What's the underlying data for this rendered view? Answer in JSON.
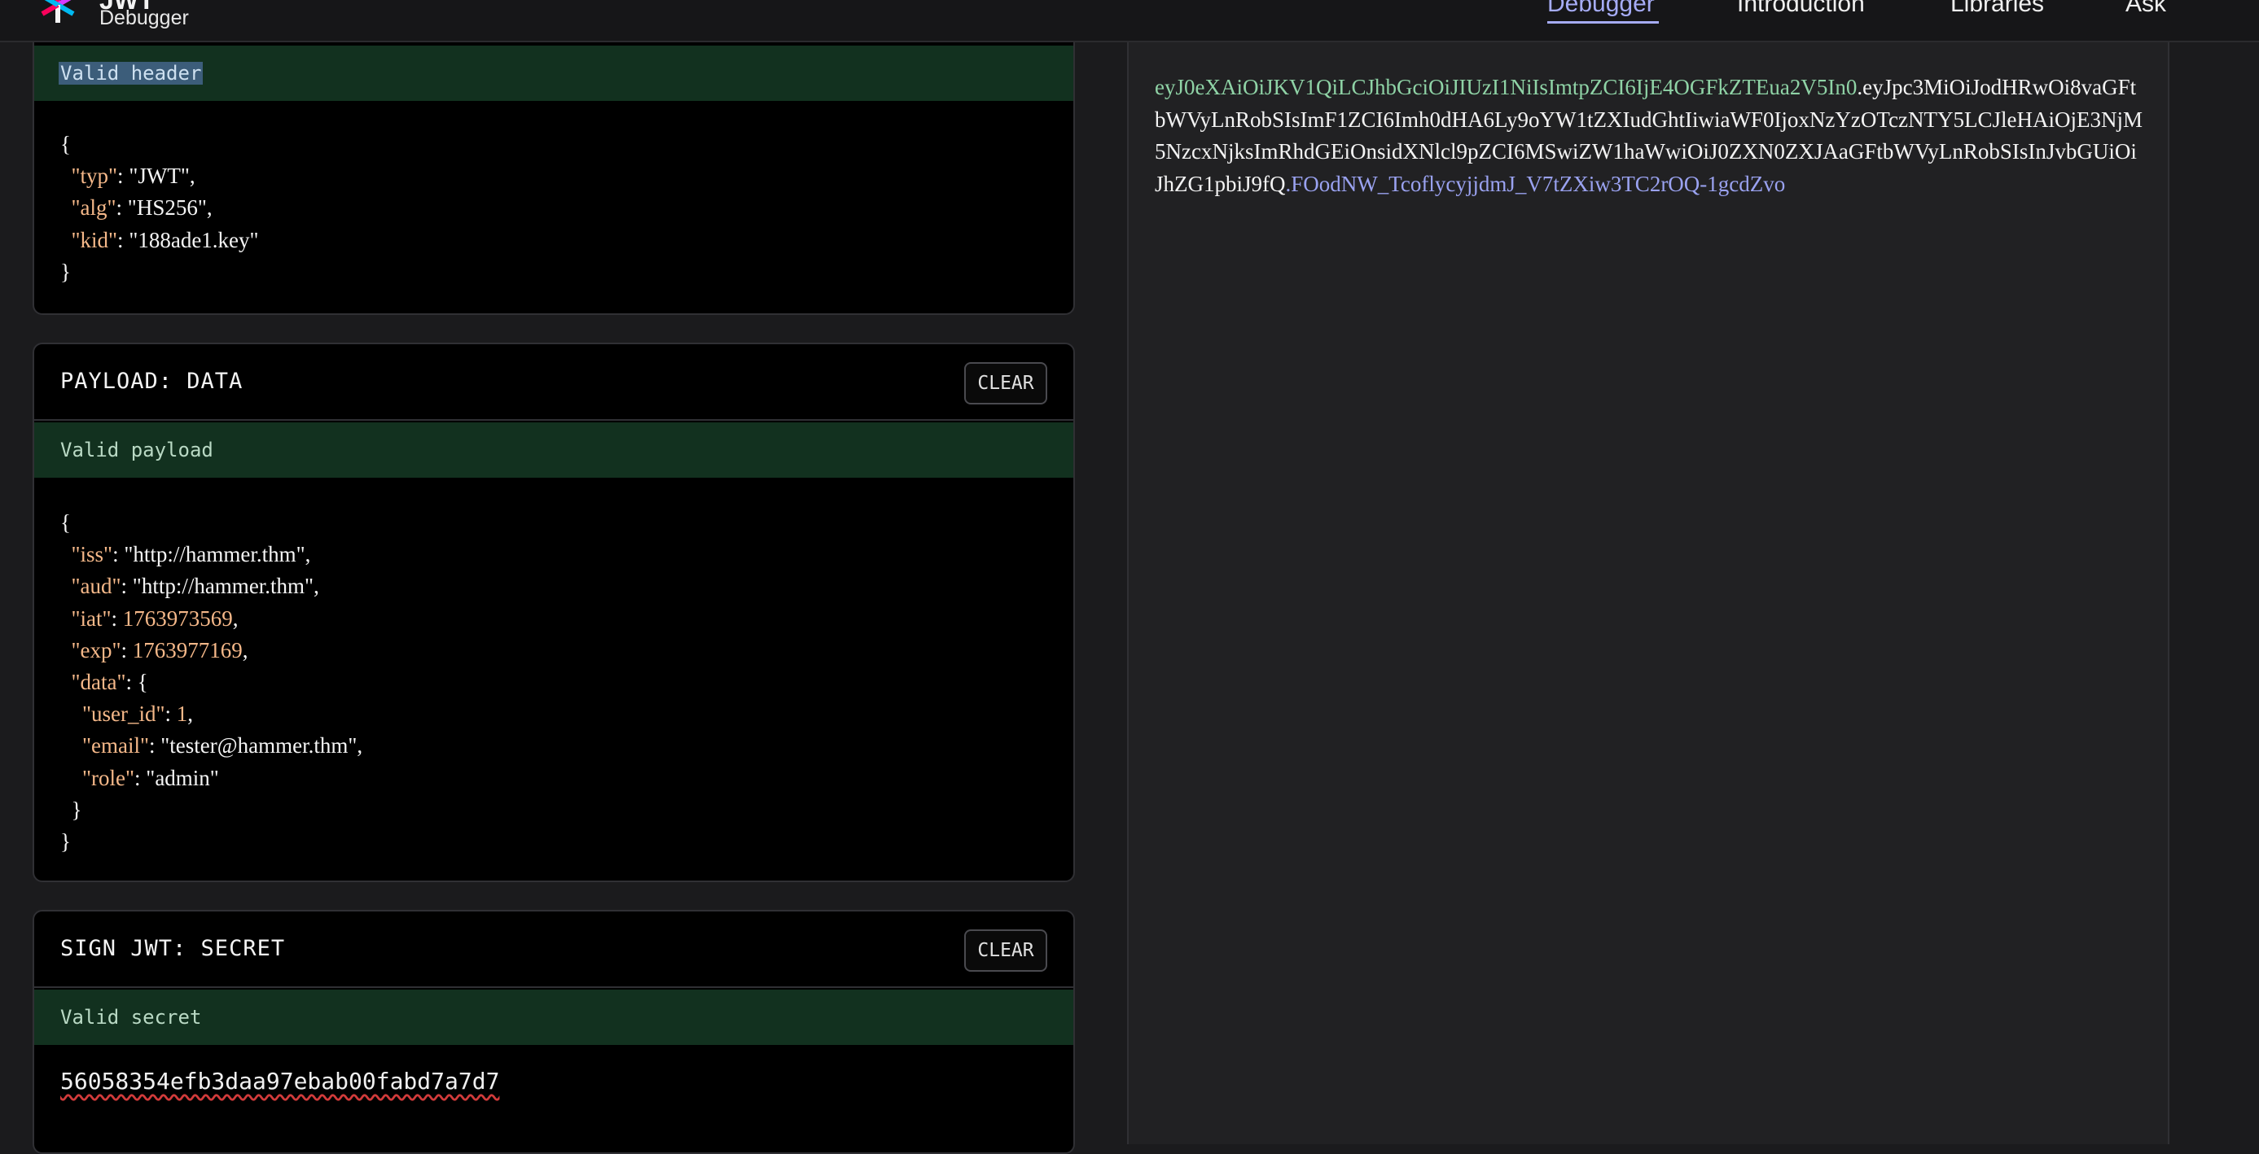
{
  "brand": {
    "title": "JWT",
    "subtitle": "Debugger"
  },
  "nav": {
    "items": [
      {
        "label": "Debugger",
        "active": true
      },
      {
        "label": "Introduction"
      },
      {
        "label": "Libraries"
      },
      {
        "label": "Ask"
      }
    ]
  },
  "header_panel": {
    "status": "Valid header",
    "lines": [
      "{",
      "  \"typ\": \"JWT\",",
      "  \"alg\": \"HS256\",",
      "  \"kid\": \"188ade1.key\"",
      "}"
    ],
    "fields": {
      "typ": "\"JWT\"",
      "alg": "\"HS256\"",
      "kid": "\"188ade1.key\""
    }
  },
  "payload_panel": {
    "title": "PAYLOAD: DATA",
    "clear_label": "CLEAR",
    "status": "Valid payload",
    "fields": {
      "iss": "\"http://hammer.thm\"",
      "aud": "\"http://hammer.thm\"",
      "iat": "1763973569",
      "exp": "1763977169",
      "user_id": "1",
      "email": "\"tester@hammer.thm\"",
      "role": "\"admin\""
    }
  },
  "secret_panel": {
    "title": "SIGN JWT: SECRET",
    "clear_label": "CLEAR",
    "status": "Valid secret",
    "value": "56058354efb3daa97ebab00fabd7a7d7"
  },
  "token": {
    "header": "eyJ0eXAiOiJKV1QiLCJhbGciOiJIUzI1NiIsImtpZCI6IjE4OGFkZTEua2V5In0",
    "payload": "eyJpc3MiOiJodHRwOi8vaGFtbWVyLnRobSIsImF1ZCI6Imh0dHA6Ly9oYW1tZXIudGhtIiwiaWF0IjoxNzYzOTczNTY5LCJleHAiOjE3NjM5NzcxNjksImRhdGEiOnsidXNlcl9pZCI6MSwiZW1haWwiOiJ0ZXN0ZXJAaGFtbWVyLnRobSIsInJvbGUiOiJhZG1pbiJ9fQ",
    "signature": "FOodNW_TcoflycyjjdmJ_V7tZXiw3TC2rOQ-1gcdZvo"
  }
}
